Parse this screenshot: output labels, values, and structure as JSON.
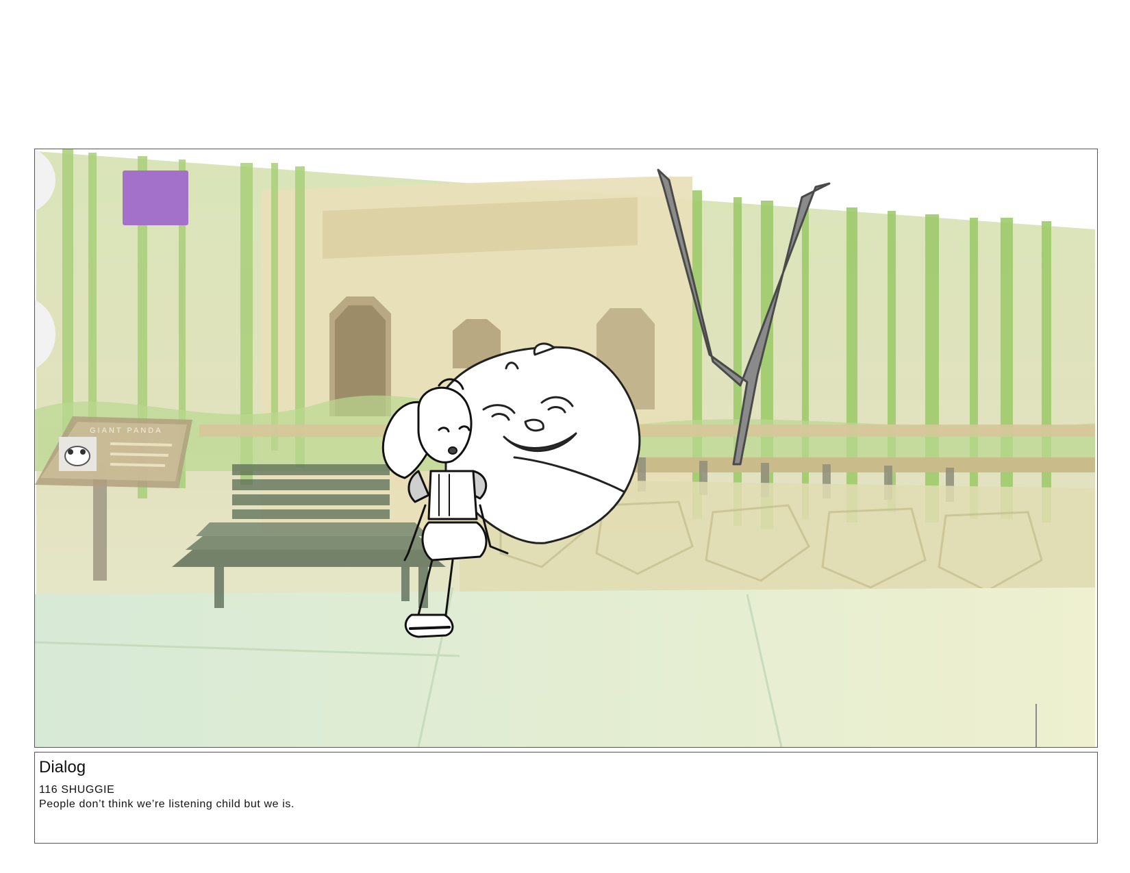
{
  "panel": {
    "marker_color": "#a371c9"
  },
  "sign": {
    "title": "GIANT PANDA"
  },
  "dialog": {
    "heading": "Dialog",
    "speaker_line": "116 SHUGGIE",
    "line_text": "People don’t think we’re listening child but we is."
  }
}
